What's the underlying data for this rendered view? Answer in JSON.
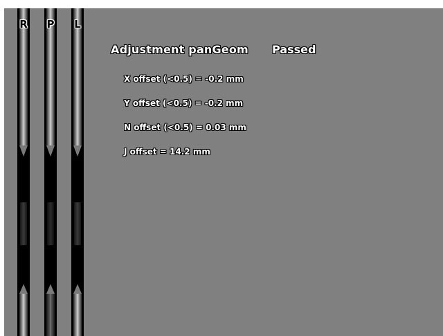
{
  "strip_labels": {
    "r": "R",
    "p": "P",
    "l": "L"
  },
  "result": {
    "title": "Adjustment panGeom",
    "status": "Passed"
  },
  "offsets": [
    "X offset (<0.5) = -0.2 mm",
    "Y offset (<0.5) = -0.2 mm",
    "N offset (<0.5) = 0.03 mm",
    "J offset = 14.2 mm"
  ],
  "colors": {
    "background": "#808080",
    "text": "#ffffff",
    "text_outline": "#000000",
    "strip": "#000000"
  }
}
